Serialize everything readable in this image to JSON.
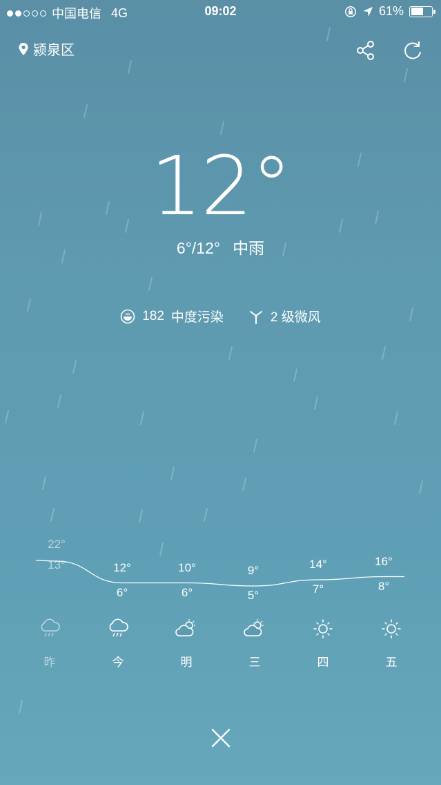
{
  "status_bar": {
    "signal_dots": [
      true,
      true,
      false,
      false,
      false
    ],
    "carrier": "中国电信",
    "network": "4G",
    "time": "09:02",
    "battery_text": "61%",
    "battery_level": 0.61
  },
  "location": {
    "name": "颍泉区"
  },
  "current": {
    "temperature": "12°",
    "range": "6°/12°",
    "condition": "中雨"
  },
  "air": {
    "aqi": "182",
    "quality": "中度污染"
  },
  "wind": {
    "text": "2 级微风"
  },
  "forecast": [
    {
      "day": "昨",
      "high": "22°",
      "low": "13°",
      "icon": "rain-cloud-icon",
      "faded": true
    },
    {
      "day": "今",
      "high": "12°",
      "low": "6°",
      "icon": "rain-cloud-icon",
      "faded": false
    },
    {
      "day": "明",
      "high": "10°",
      "low": "6°",
      "icon": "partly-cloudy-icon",
      "faded": false
    },
    {
      "day": "三",
      "high": "9°",
      "low": "5°",
      "icon": "partly-cloudy-icon",
      "faded": false
    },
    {
      "day": "四",
      "high": "14°",
      "low": "7°",
      "icon": "sun-icon",
      "faded": false
    },
    {
      "day": "五",
      "high": "16°",
      "low": "8°",
      "icon": "sun-icon",
      "faded": false
    }
  ]
}
